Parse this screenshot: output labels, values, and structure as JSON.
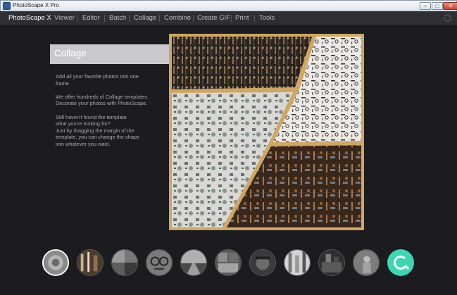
{
  "window": {
    "title": "PhotoScape X Pro",
    "controls": {
      "minimize": "–",
      "maximize": "□",
      "close": "✕"
    }
  },
  "menu": {
    "items": [
      {
        "label": "PhotoScape X",
        "active": true
      },
      {
        "label": "Viewer",
        "active": false
      },
      {
        "label": "Editor",
        "active": false
      },
      {
        "label": "Batch",
        "active": false
      },
      {
        "label": "Collage",
        "active": false
      },
      {
        "label": "Combine",
        "active": false
      },
      {
        "label": "Create GIF",
        "active": false
      },
      {
        "label": "Print",
        "active": false
      },
      {
        "label": "Tools",
        "active": false
      }
    ],
    "settings_icon": "gear-icon"
  },
  "feature": {
    "title": "Collage",
    "lines": [
      "Add all your favorite photos into one",
      "frame.",
      "",
      "We offer hundreds of Collage templates.",
      "Decorate your photos with PhotoScape.",
      "",
      "Still haven't found the template",
      "what you're looking for?",
      "Just by dragging the margin of the",
      "template, you can change the shape",
      "into whatever you want."
    ]
  },
  "collage": {
    "frame_color": "#cfa763",
    "panels": [
      "workshop-tools-photo",
      "metal-parts-photo",
      "camera-parts-photo",
      "hand-tools-photo"
    ]
  },
  "thumbnails": {
    "items": [
      "thumbnail-1",
      "thumbnail-2",
      "thumbnail-3",
      "thumbnail-4",
      "thumbnail-5",
      "thumbnail-6",
      "thumbnail-7",
      "thumbnail-8",
      "thumbnail-9",
      "thumbnail-10"
    ],
    "more_icon": "search-refresh-icon",
    "accent_color": "#3dd6b0"
  }
}
